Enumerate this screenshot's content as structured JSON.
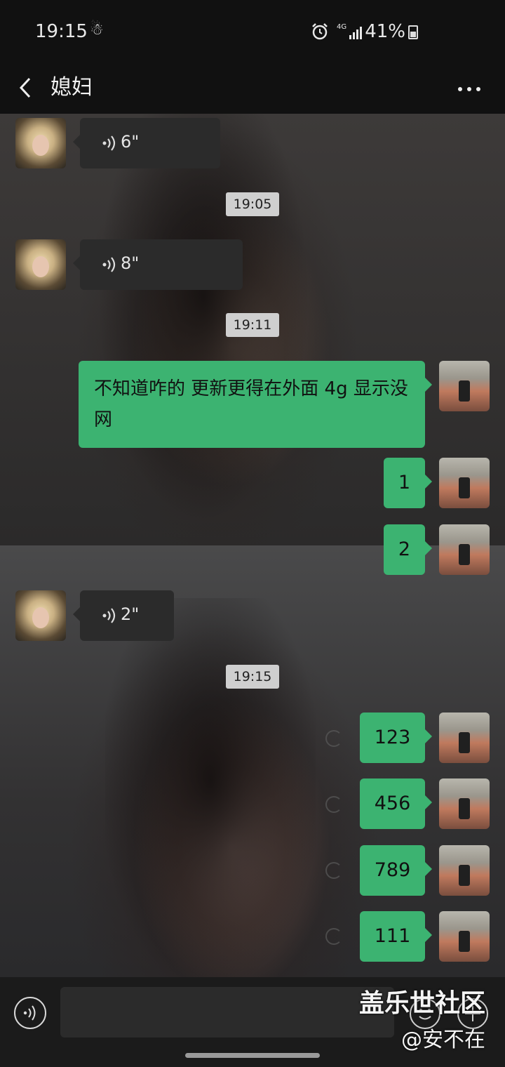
{
  "status_bar": {
    "time": "19:15",
    "extra_icon": "notification-icon",
    "network": "4G",
    "battery": "41%"
  },
  "header": {
    "title": "媳妇",
    "back_icon": "chevron-left-icon",
    "more_icon": "more-dots-icon"
  },
  "messages": [
    {
      "type": "voice",
      "from": "contact",
      "duration": "6\""
    },
    {
      "type": "timestamp",
      "text": "19:05"
    },
    {
      "type": "voice",
      "from": "contact",
      "duration": "8\""
    },
    {
      "type": "timestamp",
      "text": "19:11"
    },
    {
      "type": "text",
      "from": "me",
      "text": "不知道咋的 更新更得在外面 4g 显示没网"
    },
    {
      "type": "text",
      "from": "me",
      "text": "1"
    },
    {
      "type": "text",
      "from": "me",
      "text": "2"
    },
    {
      "type": "voice",
      "from": "contact",
      "duration": "2\""
    },
    {
      "type": "timestamp",
      "text": "19:15"
    },
    {
      "type": "text",
      "from": "me",
      "text": "123",
      "pending": true
    },
    {
      "type": "text",
      "from": "me",
      "text": "456",
      "pending": true
    },
    {
      "type": "text",
      "from": "me",
      "text": "789",
      "pending": true
    },
    {
      "type": "text",
      "from": "me",
      "text": "111",
      "pending": true
    }
  ],
  "input_bar": {
    "voice_icon": "voice-toggle-icon",
    "emoji_icon": "emoji-icon",
    "plus_icon": "plus-icon",
    "value": ""
  },
  "watermark": {
    "line1": "盖乐世社区",
    "line2": "@安不在"
  },
  "colors": {
    "outgoing_bubble": "#3cb371",
    "incoming_bubble": "#2b2b2b",
    "timestamp_bg": "#cfcfcf"
  }
}
